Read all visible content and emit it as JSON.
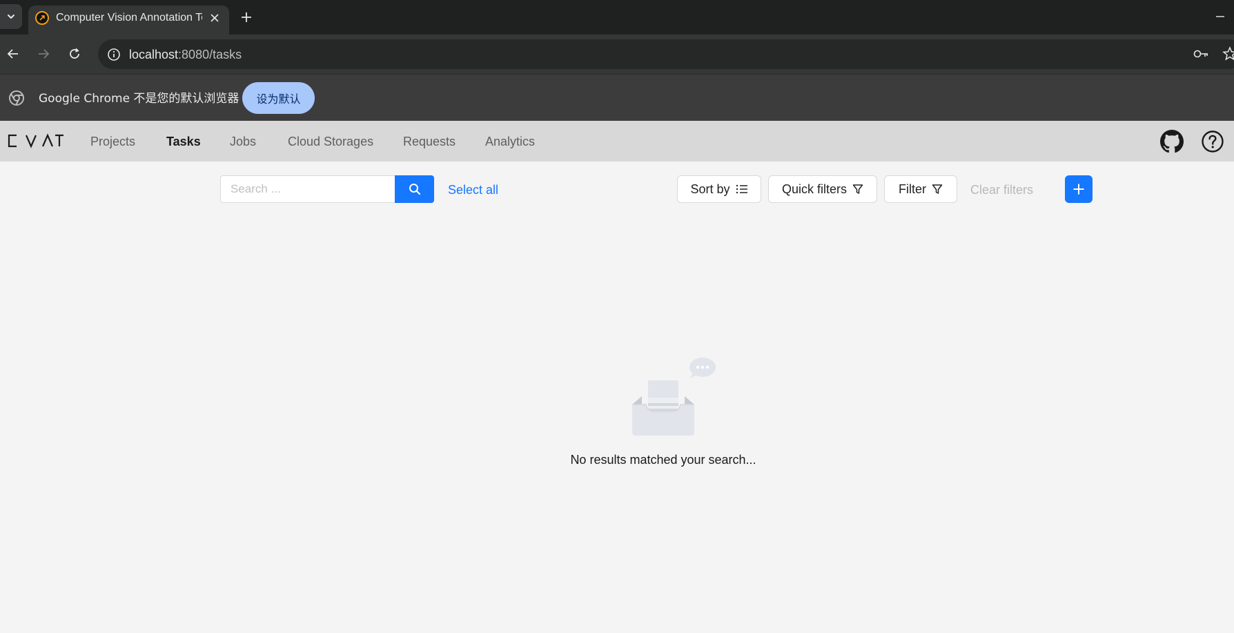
{
  "browser": {
    "tab": {
      "title": "Computer Vision Annotation Tool",
      "favicon": "cvat-favicon"
    },
    "url": {
      "host": "localhost",
      "rest": ":8080/tasks"
    }
  },
  "infobar": {
    "message": "Google Chrome 不是您的默认浏览器",
    "button_label": "设为默认"
  },
  "header": {
    "logo_text": "CVAT",
    "menu": [
      {
        "label": "Projects",
        "active": false
      },
      {
        "label": "Tasks",
        "active": true
      },
      {
        "label": "Jobs",
        "active": false
      },
      {
        "label": "Cloud Storages",
        "active": false
      },
      {
        "label": "Requests",
        "active": false
      },
      {
        "label": "Analytics",
        "active": false
      }
    ],
    "icons": [
      "github-icon",
      "help-icon"
    ]
  },
  "controls": {
    "search_placeholder": "Search ...",
    "search_value": "",
    "select_all": "Select all",
    "sort_by": "Sort by",
    "quick_filters": "Quick filters",
    "filter": "Filter",
    "clear_filters": "Clear filters"
  },
  "empty_state": {
    "message": "No results matched your search..."
  },
  "colors": {
    "primary": "#1677ff",
    "header_bg": "#d8d8d8",
    "page_bg": "#f4f4f4",
    "chrome_dark": "#1f2020"
  }
}
